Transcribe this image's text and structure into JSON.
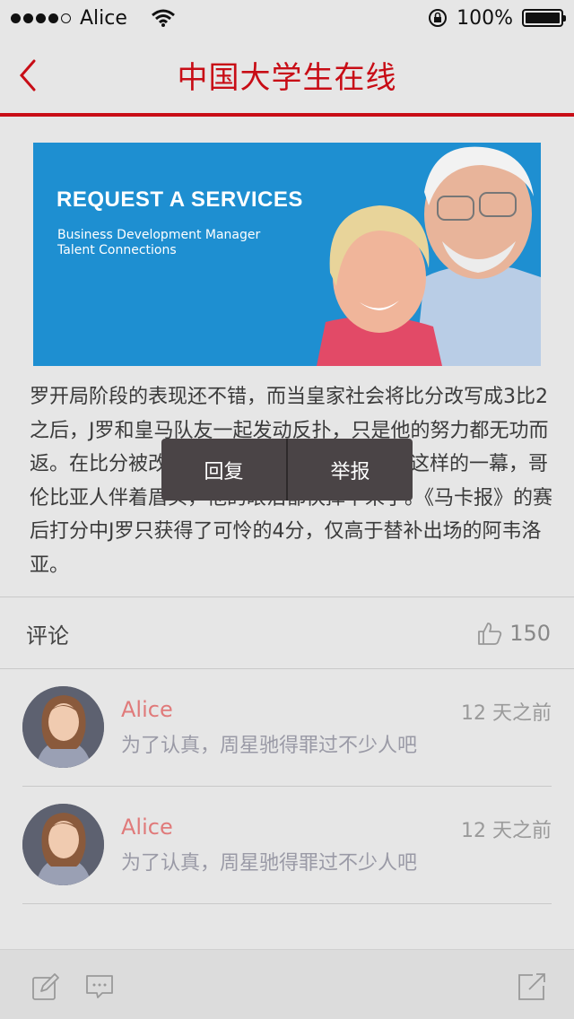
{
  "status_bar": {
    "carrier": "Alice",
    "battery": "100%",
    "battery_level": 1.0,
    "icons": [
      "signal-dots-icon",
      "wifi-icon",
      "rotation-lock-icon",
      "battery-icon"
    ]
  },
  "nav": {
    "title": "中国大学生在线",
    "back_icon": "chevron-left-icon"
  },
  "banner": {
    "headline": "REQUEST A SERVICES",
    "sub_line1": "Business Development Manager",
    "sub_line2": "Talent Connections"
  },
  "article": {
    "text": "罗开局阶段的表现还不错，而当皇家社会将比分改写成3比2之后，J罗和皇马队友一起发动反扑，只是他的努力都无功而返。在比分被改写为3比2后，镜头捕捉到了这样的一幕，哥伦比亚人伴着眉头，他的眼泪都快掉下来了。《马卡报》的赛后打分中J罗只获得了可怜的4分，仅高于替补出场的阿韦洛亚。"
  },
  "popup": {
    "reply_label": "回复",
    "report_label": "举报"
  },
  "comments_section": {
    "label": "评论",
    "like_count": "150",
    "like_icon": "thumbs-up-icon"
  },
  "comments": [
    {
      "name": "Alice",
      "time": "12 天之前",
      "text": "为了认真，周星驰得罪过不少人吧"
    },
    {
      "name": "Alice",
      "time": "12 天之前",
      "text": "为了认真，周星驰得罪过不少人吧"
    }
  ],
  "toolbar": {
    "icons": [
      "edit-icon",
      "comment-icon",
      "share-icon"
    ]
  },
  "colors": {
    "accent": "#c80d16",
    "banner_bg": "#1e8fd1",
    "comment_name": "#e07a7a",
    "popup_bg": "#4a4446"
  }
}
